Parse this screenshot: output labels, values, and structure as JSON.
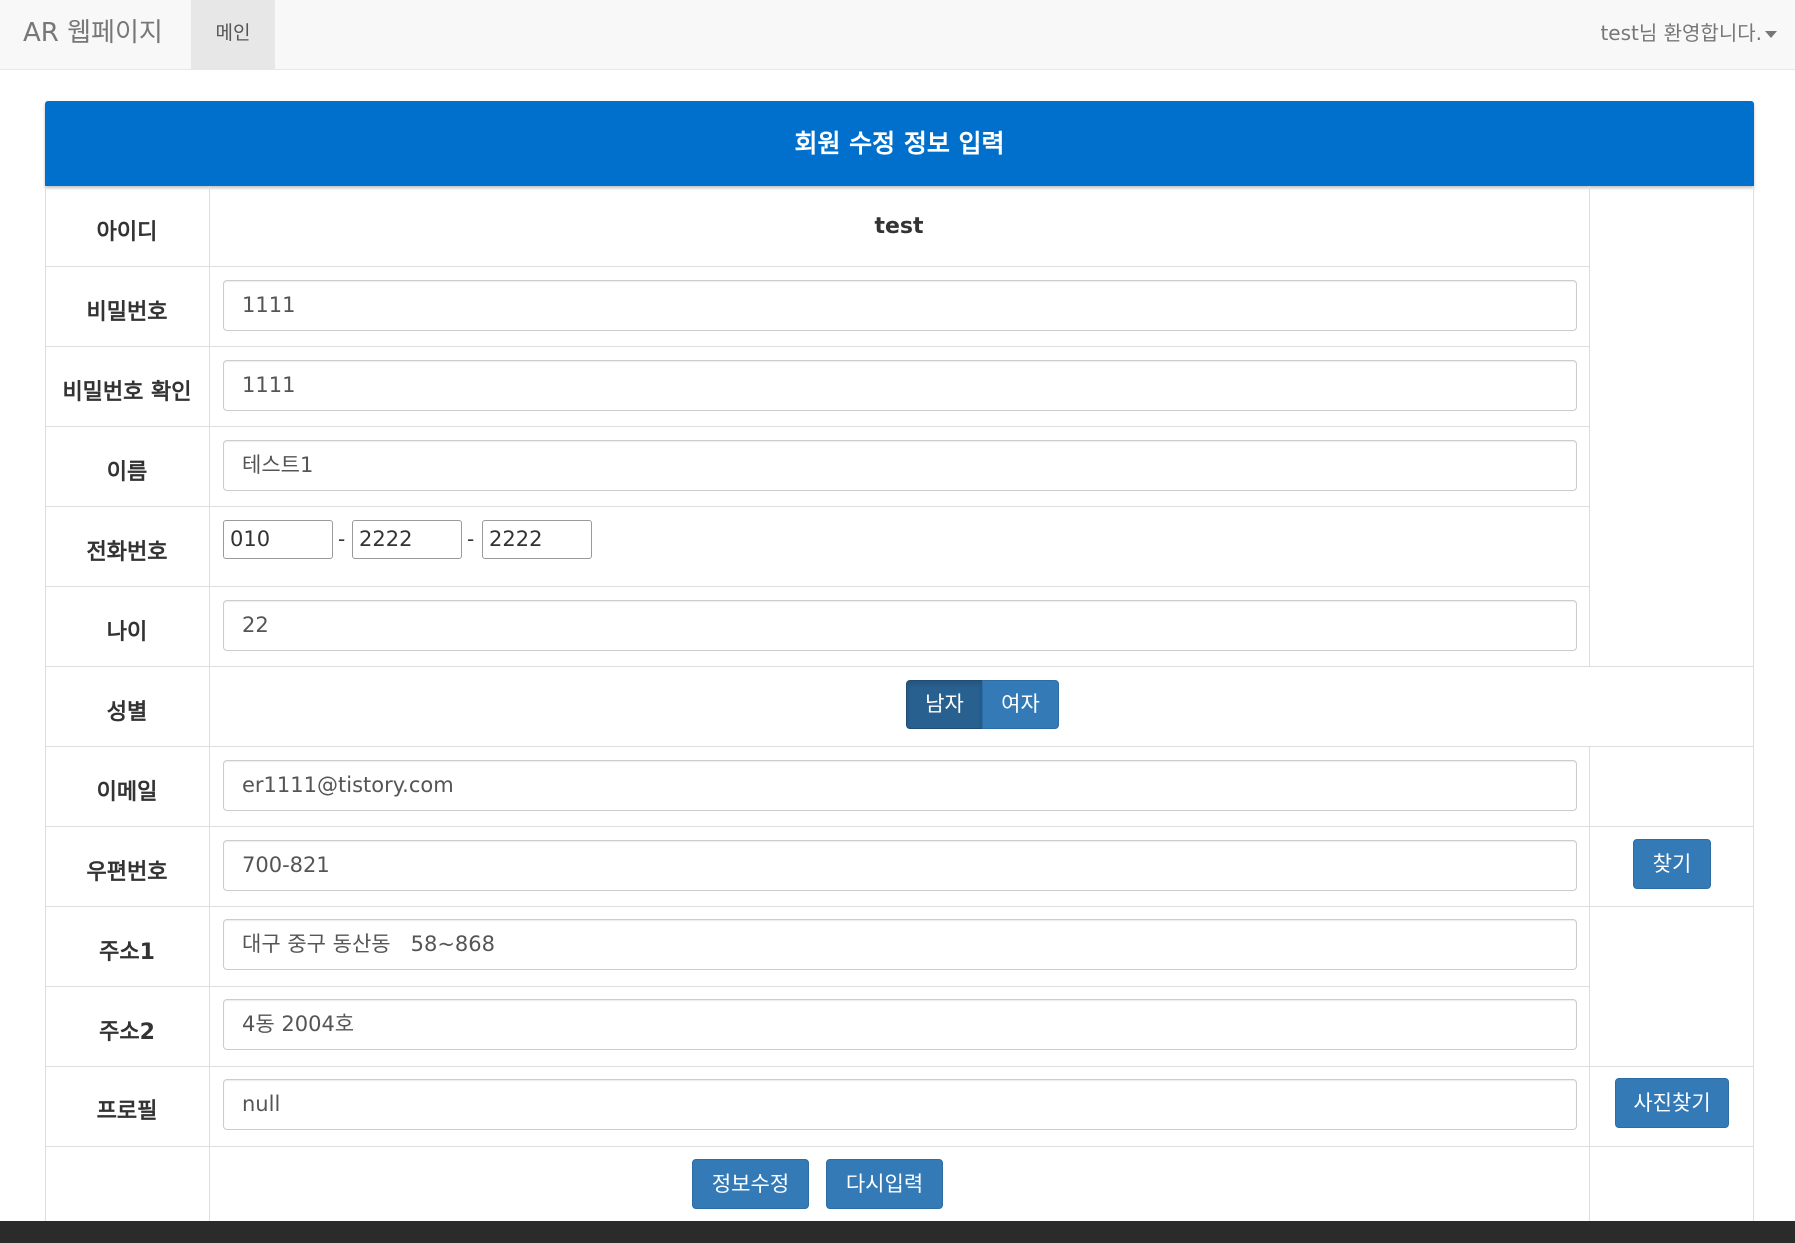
{
  "navbar": {
    "brand": "AR 웹페이지",
    "tab_main": "메인",
    "user_greeting": "test님 환영합니다."
  },
  "form": {
    "title": "회원 수정 정보 입력",
    "id_label": "아이디",
    "id_value": "test",
    "password_label": "비밀번호",
    "password_value": "1111",
    "password_confirm_label": "비밀번호 확인",
    "password_confirm_value": "1111",
    "name_label": "이름",
    "name_value": "테스트1",
    "phone_label": "전화번호",
    "phone_sep": "-",
    "phone": [
      "010",
      "2222",
      "2222"
    ],
    "age_label": "나이",
    "age_value": "22",
    "gender_label": "성별",
    "gender_options": [
      "남자",
      "여자"
    ],
    "gender_selected": "남자",
    "email_label": "이메일",
    "email_value": "er1111@tistory.com",
    "zip_label": "우편번호",
    "zip_value": "700-821",
    "zip_search_button": "찾기",
    "address1_label": "주소1",
    "address1_value": "대구 중구 동산동   58~868",
    "address2_label": "주소2",
    "address2_value": "4동 2004호",
    "profile_label": "프로필",
    "profile_value": "null",
    "profile_search_button": "사진찾기",
    "submit_button": "정보수정",
    "reset_button": "다시입력"
  },
  "colors": {
    "header_blue": "#0070cc",
    "button_blue": "#337ab7",
    "button_active": "#286090"
  }
}
